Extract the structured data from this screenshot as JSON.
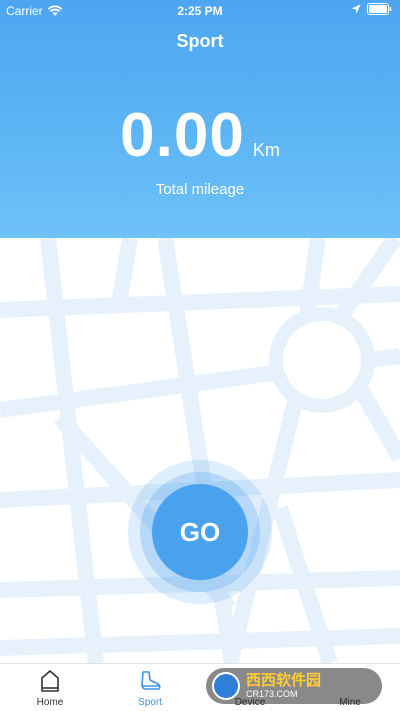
{
  "status_bar": {
    "carrier": "Carrier",
    "time": "2:25 PM"
  },
  "header": {
    "title": "Sport",
    "distance_value": "0.00",
    "distance_unit": "Km",
    "mileage_label": "Total mileage"
  },
  "go_button": {
    "label": "GO"
  },
  "tabs": [
    {
      "label": "Home",
      "icon": "home-icon",
      "active": false
    },
    {
      "label": "Sport",
      "icon": "shoe-icon",
      "active": true
    },
    {
      "label": "Device",
      "icon": "device-icon",
      "active": false
    },
    {
      "label": "Mine",
      "icon": "person-icon",
      "active": false
    }
  ],
  "watermark": {
    "text_cn": "西西软件园",
    "text_en": "CR173.COM"
  },
  "colors": {
    "accent": "#4aa2ef",
    "header_top": "#4ea6f1",
    "header_bottom": "#6ec2f8",
    "map_road": "#e6f1fb",
    "active_tab": "#3d93e6"
  }
}
